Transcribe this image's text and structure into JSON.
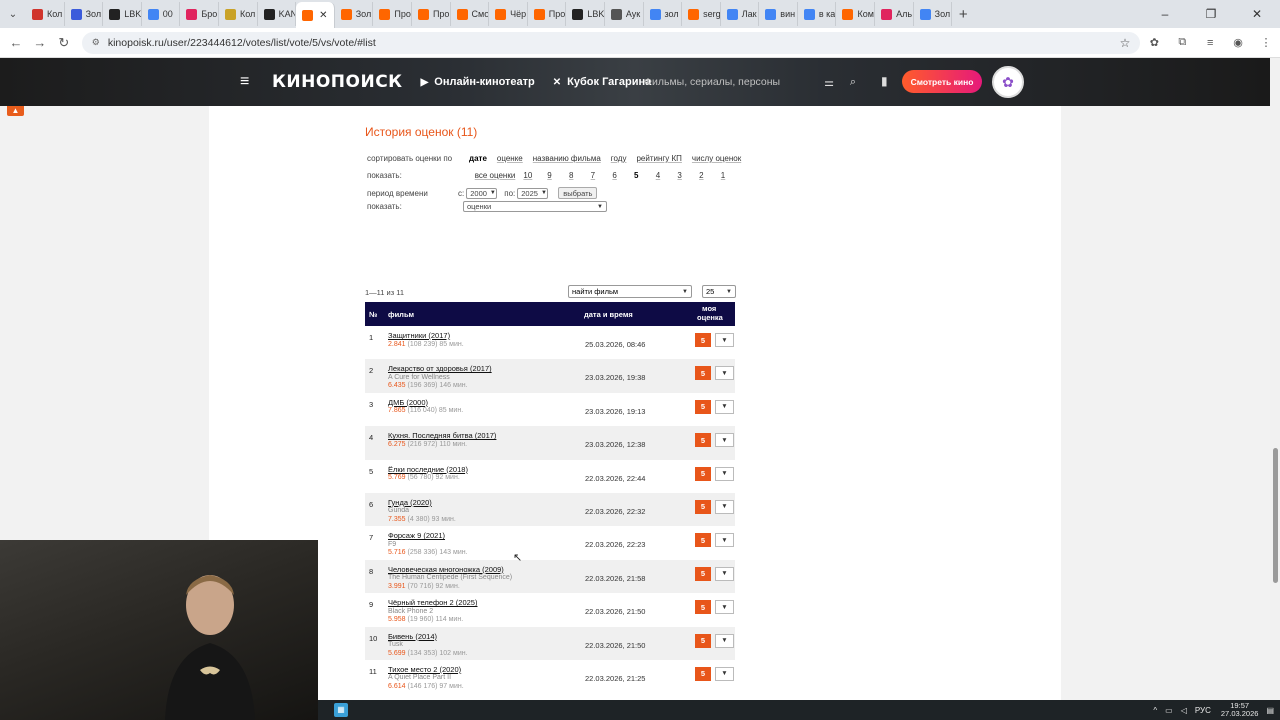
{
  "browser": {
    "tabs": [
      {
        "label": "Кол",
        "color": "#d0342c",
        "icon": "cookie-icon"
      },
      {
        "label": "Зол",
        "color": "#3b5bdb",
        "icon": "play-icon"
      },
      {
        "label": "LBK",
        "color": "#222222",
        "icon": "page-icon"
      },
      {
        "label": "00",
        "color": "#4285f4",
        "icon": "google-icon"
      },
      {
        "label": "Бро",
        "color": "#e0245e",
        "icon": "app-icon"
      },
      {
        "label": "Кол",
        "color": "#c9a227",
        "icon": "app-icon"
      },
      {
        "label": "KAN",
        "color": "#222222",
        "icon": "page-icon"
      },
      {
        "label": "",
        "color": "#ff6600",
        "icon": "kinopoisk-icon",
        "active": true
      },
      {
        "label": "Зол",
        "color": "#ff6600",
        "icon": "kinopoisk-icon"
      },
      {
        "label": "Про",
        "color": "#ff6600",
        "icon": "kinopoisk-icon"
      },
      {
        "label": "Про",
        "color": "#ff6600",
        "icon": "kinopoisk-icon"
      },
      {
        "label": "Смо",
        "color": "#ff6600",
        "icon": "kinopoisk-icon"
      },
      {
        "label": "Чёр",
        "color": "#ff6600",
        "icon": "kinopoisk-icon"
      },
      {
        "label": "Про",
        "color": "#ff6600",
        "icon": "kinopoisk-icon"
      },
      {
        "label": "LBK",
        "color": "#222222",
        "icon": "page-icon"
      },
      {
        "label": "Аук",
        "color": "#555555",
        "icon": "app-icon"
      },
      {
        "label": "зол",
        "color": "#4285f4",
        "icon": "google-icon"
      },
      {
        "label": "serg",
        "color": "#ff6600",
        "icon": "kinopoisk-icon"
      },
      {
        "label": "Лак",
        "color": "#4285f4",
        "icon": "google-icon"
      },
      {
        "label": "вин",
        "color": "#4285f4",
        "icon": "google-icon"
      },
      {
        "label": "в ка",
        "color": "#4285f4",
        "icon": "google-icon"
      },
      {
        "label": "Ком",
        "color": "#ff6600",
        "icon": "kinopoisk-icon"
      },
      {
        "label": "Аль",
        "color": "#e0245e",
        "icon": "app-icon"
      },
      {
        "label": "Зол",
        "color": "#4285f4",
        "icon": "google-icon"
      }
    ],
    "url": "kinopoisk.ru/user/223444612/votes/list/vote/5/vs/vote/#list"
  },
  "header": {
    "logo": "КИНОПОИСК",
    "nav_online": "Онлайн-кинотеатр",
    "nav_cup": "Кубок Гагарина",
    "search_placeholder": "Фильмы, сериалы, персоны",
    "watch_button": "Смотреть кино"
  },
  "history": {
    "title": "История оценок (11)",
    "sort_label": "сортировать оценки по",
    "sort_options": [
      "дате",
      "оценке",
      "названию фильма",
      "году",
      "рейтингу КП",
      "числу оценок"
    ],
    "show_label": "показать:",
    "rating_filters": [
      "все оценки",
      "10",
      "9",
      "8",
      "7",
      "6",
      "5",
      "4",
      "3",
      "2",
      "1"
    ],
    "period_label": "период времени",
    "from_label": "с:",
    "from_year": "2000",
    "to_label": "по:",
    "to_year": "2025",
    "select_button": "выбрать",
    "show_label2": "показать:",
    "show_value": "оценки",
    "count_text": "1—11 из 11",
    "find_film_placeholder": "найти фильм",
    "per_page": "25"
  },
  "table": {
    "col_num": "№",
    "col_film": "фильм",
    "col_date": "дата и время",
    "col_rating_1": "моя",
    "col_rating_2": "оценка",
    "rows": [
      {
        "num": "1",
        "title": "Защитники (2017)",
        "orig": "",
        "rating": "2.841",
        "meta": "(108 239) 85 мин.",
        "date": "25.03.2026, 08:46",
        "vote": "5"
      },
      {
        "num": "2",
        "title": "Лекарство от здоровья (2017)",
        "orig": "A Cure for Wellness",
        "rating": "6.435",
        "meta": "(196 369) 146 мин.",
        "date": "23.03.2026, 19:38",
        "vote": "5"
      },
      {
        "num": "3",
        "title": "ДМБ (2000)",
        "orig": "",
        "rating": "7.865",
        "meta": "(116 040) 85 мин.",
        "date": "23.03.2026, 19:13",
        "vote": "5"
      },
      {
        "num": "4",
        "title": "Кухня. Последняя битва (2017)",
        "orig": "",
        "rating": "6.275",
        "meta": "(216 972) 110 мин.",
        "date": "23.03.2026, 12:38",
        "vote": "5"
      },
      {
        "num": "5",
        "title": "Ёлки последние (2018)",
        "orig": "",
        "rating": "5.769",
        "meta": "(56 780) 92 мин.",
        "date": "22.03.2026, 22:44",
        "vote": "5"
      },
      {
        "num": "6",
        "title": "Гунда (2020)",
        "orig": "Gunda",
        "rating": "7.355",
        "meta": "(4 380) 93 мин.",
        "date": "22.03.2026, 22:32",
        "vote": "5"
      },
      {
        "num": "7",
        "title": "Форсаж 9 (2021)",
        "orig": "F9",
        "rating": "5.716",
        "meta": "(258 336) 143 мин.",
        "date": "22.03.2026, 22:23",
        "vote": "5"
      },
      {
        "num": "8",
        "title": "Человеческая многоножка (2009)",
        "orig": "The Human Centipede (First Sequence)",
        "rating": "3.991",
        "meta": "(70 716) 92 мин.",
        "date": "22.03.2026, 21:58",
        "vote": "5"
      },
      {
        "num": "9",
        "title": "Чёрный телефон 2 (2025)",
        "orig": "Black Phone 2",
        "rating": "5.958",
        "meta": "(19 960) 114 мин.",
        "date": "22.03.2026, 21:50",
        "vote": "5"
      },
      {
        "num": "10",
        "title": "Бивень (2014)",
        "orig": "Tusk",
        "rating": "5.699",
        "meta": "(134 353) 102 мин.",
        "date": "22.03.2026, 21:50",
        "vote": "5"
      },
      {
        "num": "11",
        "title": "Тихое место 2 (2020)",
        "orig": "A Quiet Place Part II",
        "rating": "6.614",
        "meta": "(146 176) 97 мин.",
        "date": "22.03.2026, 21:25",
        "vote": "5"
      }
    ]
  },
  "taskbar": {
    "lang": "РУС",
    "time": "19:57",
    "date": "27.03.2026"
  }
}
